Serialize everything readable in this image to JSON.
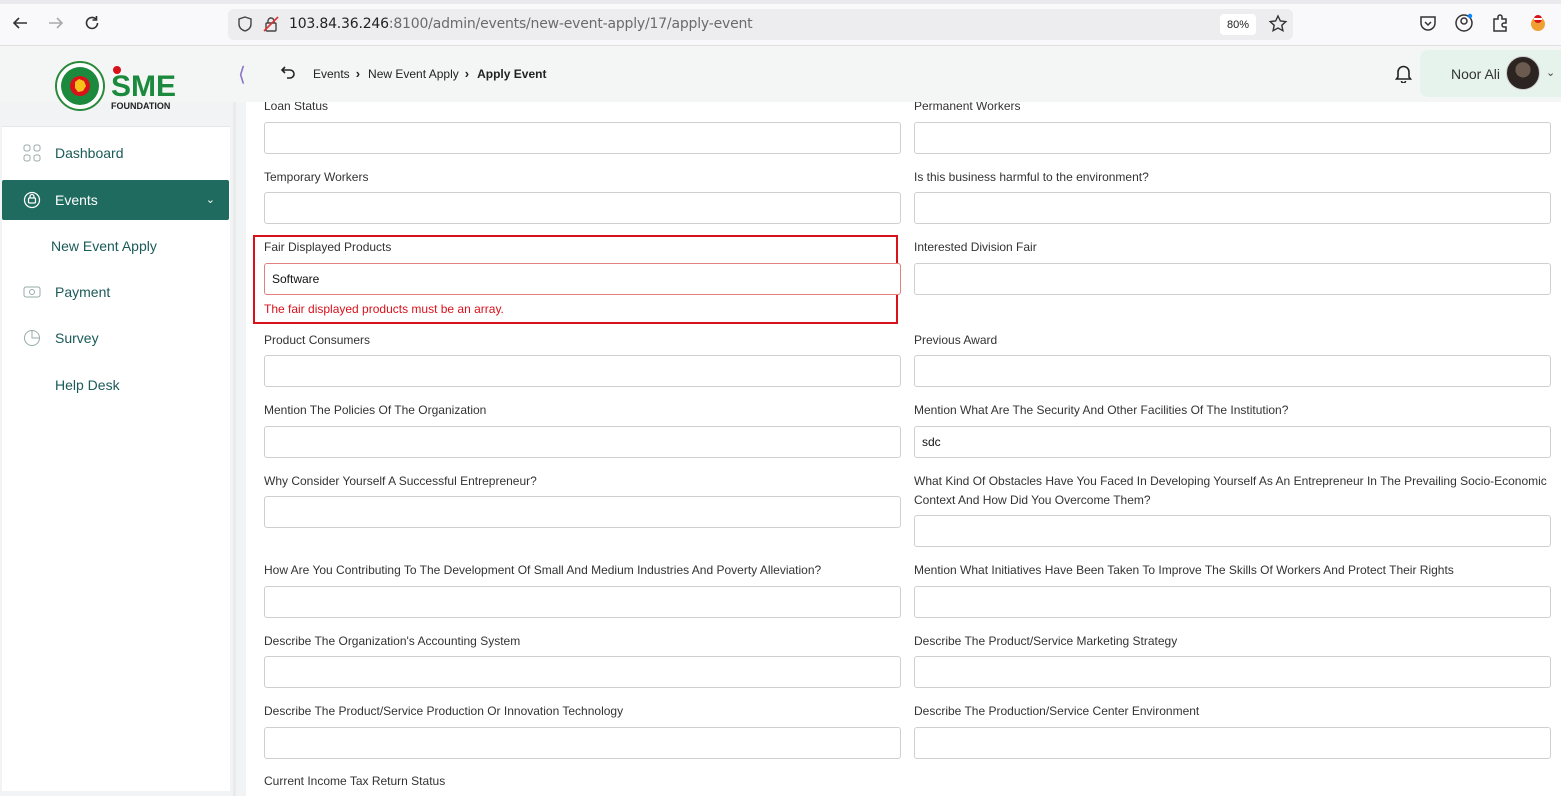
{
  "browser": {
    "url_host": "103.84.36.246",
    "url_path": ":8100/admin/events/new-event-apply/17/apply-event",
    "zoom": "80%"
  },
  "header": {
    "logo_text": "SME",
    "logo_sub": "FOUNDATION",
    "breadcrumb": [
      "Events",
      "New Event Apply",
      "Apply Event"
    ],
    "user_name": "Noor Ali"
  },
  "sidebar": {
    "items": [
      {
        "label": "Dashboard",
        "icon": "grid-icon"
      },
      {
        "label": "Events",
        "icon": "events-icon"
      },
      {
        "label": "New Event Apply"
      },
      {
        "label": "Payment",
        "icon": "payment-icon"
      },
      {
        "label": "Survey",
        "icon": "pie-chart-icon"
      },
      {
        "label": "Help Desk"
      }
    ]
  },
  "form": {
    "loan_status": {
      "label": "Loan Status",
      "value": ""
    },
    "permanent_workers": {
      "label": "Permanent Workers",
      "value": ""
    },
    "temporary_workers": {
      "label": "Temporary Workers",
      "value": ""
    },
    "harmful_env": {
      "label": "Is this business harmful to the environment?",
      "value": ""
    },
    "fair_products": {
      "label": "Fair Displayed Products",
      "value": "Software",
      "error": "The fair displayed products must be an array."
    },
    "interested_division": {
      "label": "Interested Division Fair",
      "value": ""
    },
    "product_consumers": {
      "label": "Product Consumers",
      "value": ""
    },
    "previous_award": {
      "label": "Previous Award",
      "value": ""
    },
    "policies": {
      "label": "Mention The Policies Of The Organization",
      "value": ""
    },
    "security_facilities": {
      "label": "Mention What Are The Security And Other Facilities Of The Institution?",
      "value": "sdc"
    },
    "successful": {
      "label": "Why Consider Yourself A Successful Entrepreneur?",
      "value": ""
    },
    "obstacles": {
      "label_line1": "What Kind Of Obstacles Have You Faced In Developing Yourself As An Entrepreneur In The Prevailing Socio-Economic",
      "label_line2": "Context And How Did You Overcome Them?",
      "value": ""
    },
    "contributing": {
      "label": "How Are You Contributing To The Development Of Small And Medium Industries And Poverty Alleviation?",
      "value": ""
    },
    "initiatives": {
      "label": "Mention What Initiatives Have Been Taken To Improve The Skills Of Workers And Protect Their Rights",
      "value": ""
    },
    "accounting": {
      "label": "Describe The Organization's Accounting System",
      "value": ""
    },
    "marketing": {
      "label": "Describe The Product/Service Marketing Strategy",
      "value": ""
    },
    "production_tech": {
      "label": "Describe The Product/Service Production Or Innovation Technology",
      "value": ""
    },
    "production_env": {
      "label": "Describe The Production/Service Center Environment",
      "value": ""
    },
    "income_tax": {
      "label": "Current Income Tax Return Status"
    }
  }
}
